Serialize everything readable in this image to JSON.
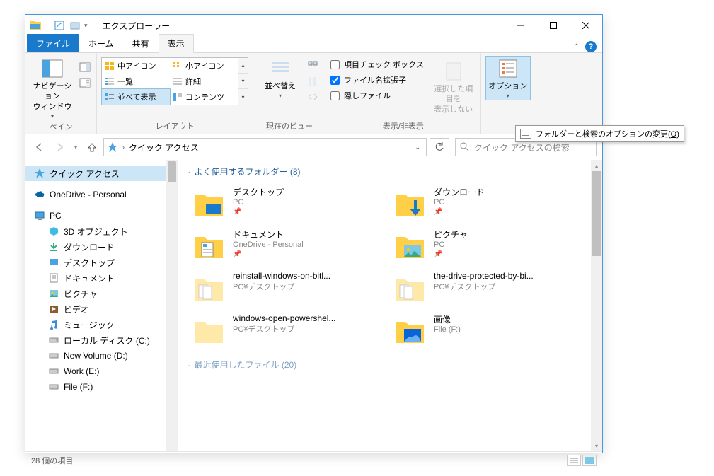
{
  "window": {
    "title": "エクスプローラー"
  },
  "tabs": {
    "file": "ファイル",
    "home": "ホーム",
    "share": "共有",
    "view": "表示"
  },
  "ribbon": {
    "pane": {
      "nav_pane": "ナビゲーション\nウィンドウ",
      "label": "ペイン"
    },
    "layout": {
      "items": [
        "中アイコン",
        "小アイコン",
        "一覧",
        "詳細",
        "並べて表示",
        "コンテンツ"
      ],
      "label": "レイアウト"
    },
    "sort": {
      "sort_by": "並べ替え",
      "label": "現在のビュー"
    },
    "show_hide": {
      "check_boxes": "項目チェック ボックス",
      "extensions": "ファイル名拡張子",
      "hidden": "隠しファイル",
      "hide_selected": "選択した項目を\n表示しない",
      "label": "表示/非表示"
    },
    "options": {
      "options": "オプション"
    }
  },
  "tooltip": {
    "text": "フォルダーと検索のオプションの変更(O)"
  },
  "address": {
    "location": "クイック アクセス"
  },
  "search": {
    "placeholder": "クイック アクセスの検索"
  },
  "nav_tree": {
    "quick_access": "クイック アクセス",
    "onedrive": "OneDrive - Personal",
    "pc": "PC",
    "pc_children": [
      "3D オブジェクト",
      "ダウンロード",
      "デスクトップ",
      "ドキュメント",
      "ピクチャ",
      "ビデオ",
      "ミュージック",
      "ローカル ディスク (C:)",
      "New Volume (D:)",
      "Work (E:)",
      "File (F:)"
    ]
  },
  "sections": {
    "freq": {
      "title": "よく使用するフォルダー (8)"
    },
    "recent": {
      "title": "最近使用したファイル (20)"
    }
  },
  "folders": [
    {
      "name": "デスクトップ",
      "loc": "PC",
      "pinned": true
    },
    {
      "name": "ダウンロード",
      "loc": "PC",
      "pinned": true
    },
    {
      "name": "ドキュメント",
      "loc": "OneDrive - Personal",
      "pinned": true
    },
    {
      "name": "ピクチャ",
      "loc": "PC",
      "pinned": true
    },
    {
      "name": "reinstall-windows-on-bitl...",
      "loc": "PC¥デスクトップ",
      "pinned": false
    },
    {
      "name": "the-drive-protected-by-bi...",
      "loc": "PC¥デスクトップ",
      "pinned": false
    },
    {
      "name": "windows-open-powershel...",
      "loc": "PC¥デスクトップ",
      "pinned": false
    },
    {
      "name": "画像",
      "loc": "File (F:)",
      "pinned": false
    }
  ],
  "status": {
    "count": "28 個の項目"
  }
}
